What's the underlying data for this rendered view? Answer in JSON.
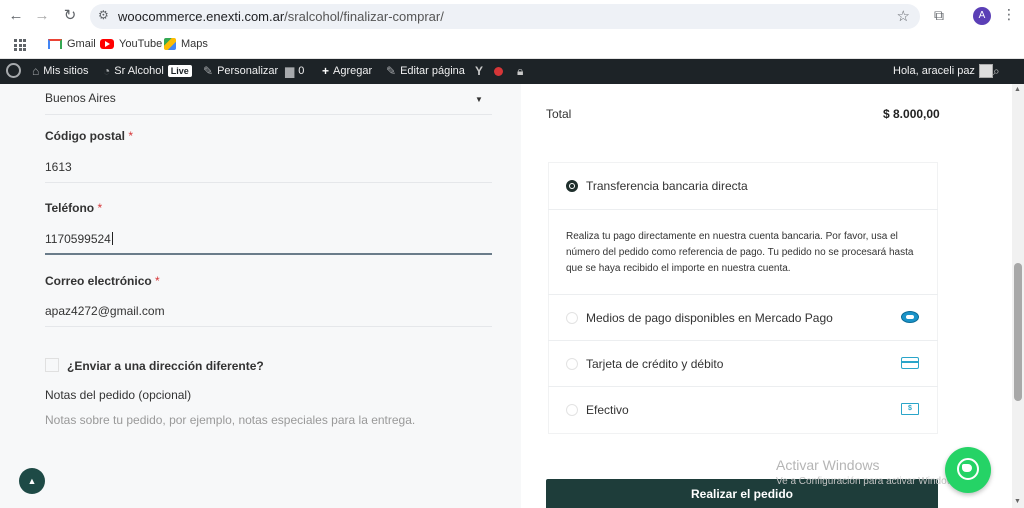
{
  "browser": {
    "url_host": "woocommerce.enexti.com.ar",
    "url_path": "/sralcohol/finalizar-comprar/",
    "profile_initial": "A",
    "bookmarks": [
      {
        "label": "Gmail",
        "icon": "gmail-icon"
      },
      {
        "label": "YouTube",
        "icon": "youtube-icon"
      },
      {
        "label": "Maps",
        "icon": "maps-icon"
      }
    ]
  },
  "adminbar": {
    "my_sites": "Mis sitios",
    "site_name": "Sr Alcohol",
    "live_badge": "Live",
    "customize": "Personalizar",
    "comments_count": "0",
    "add_new": "Agregar",
    "edit_page": "Editar página",
    "greeting": "Hola, araceli paz"
  },
  "form": {
    "state_value": "Buenos Aires",
    "postal_label": "Código postal",
    "postal_value": "1613",
    "phone_label": "Teléfono",
    "phone_value": "1170599524",
    "email_label": "Correo electrónico",
    "email_value": "apaz4272@gmail.com",
    "ship_different": "¿Enviar a una dirección diferente?",
    "notes_label": "Notas del pedido (opcional)",
    "notes_placeholder": "Notas sobre tu pedido, por ejemplo, notas especiales para la entrega.",
    "required_mark": "*"
  },
  "order": {
    "total_label": "Total",
    "total_value": "$ 8.000,00",
    "payment_methods": [
      {
        "label": "Transferencia bancaria directa",
        "selected": true
      },
      {
        "label": "Medios de pago disponibles en Mercado Pago",
        "selected": false,
        "icon": "mercadopago-icon"
      },
      {
        "label": "Tarjeta de crédito y débito",
        "selected": false,
        "icon": "credit-card-icon"
      },
      {
        "label": "Efectivo",
        "selected": false,
        "icon": "cash-icon"
      }
    ],
    "bank_transfer_desc": "Realiza tu pago directamente en nuestra cuenta bancaria. Por favor, usa el número del pedido como referencia de pago. Tu pedido no se procesará hasta que se haya recibido el importe en nuestra cuenta.",
    "place_order": "Realizar el pedido"
  },
  "watermark": {
    "title": "Activar Windows",
    "subtitle": "Ve a Configuración para activar Windows."
  },
  "colors": {
    "primary_dark": "#1e3d3a",
    "whatsapp": "#25d366",
    "required": "#d63638"
  }
}
